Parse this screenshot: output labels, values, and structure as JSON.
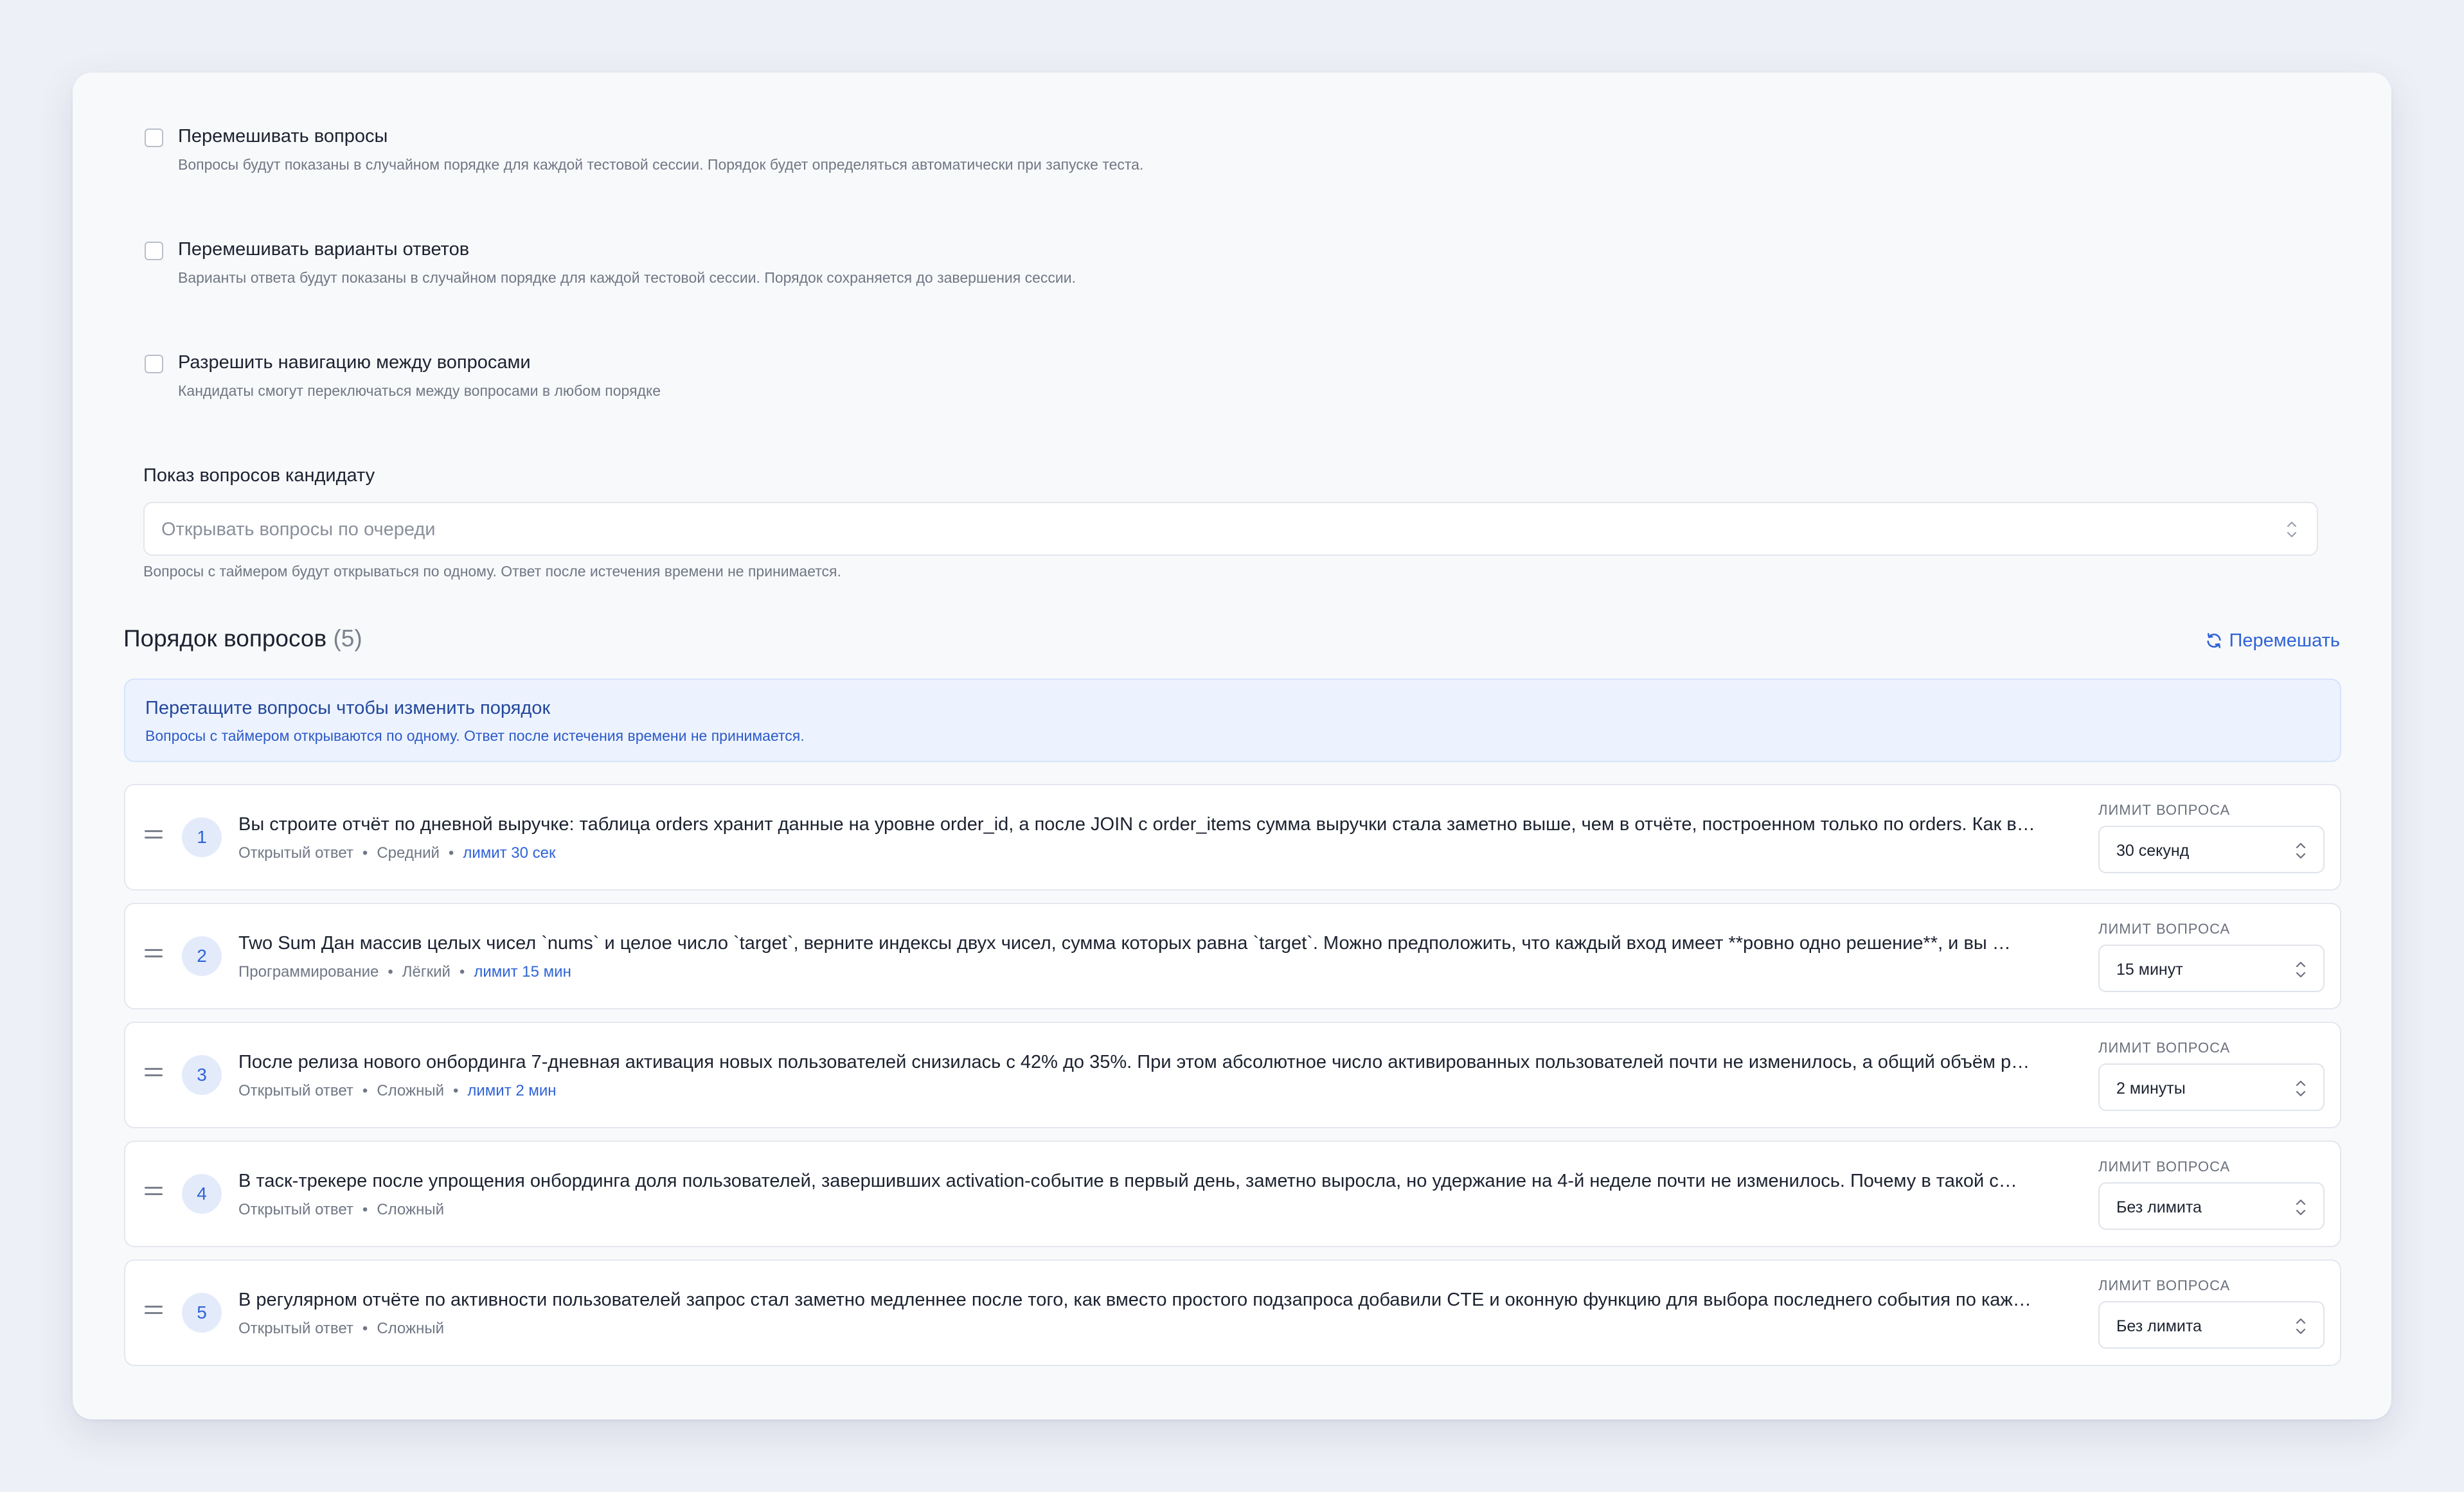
{
  "options": [
    {
      "title": "Перемешивать вопросы",
      "description": "Вопросы будут показаны в случайном порядке для каждой тестовой сессии. Порядок будет определяться автоматически при запуске теста.",
      "checked": false
    },
    {
      "title": "Перемешивать варианты ответов",
      "description": "Варианты ответа будут показаны в случайном порядке для каждой тестовой сессии. Порядок сохраняется до завершения сессии.",
      "checked": false
    },
    {
      "title": "Разрешить навигацию между вопросами",
      "description": "Кандидаты смогут переключаться между вопросами в любом порядке",
      "checked": false
    }
  ],
  "display": {
    "label": "Показ вопросов кандидату",
    "placeholder": "Открывать вопросы по очереди",
    "hint": "Вопросы с таймером будут открываться по одному. Ответ после истечения времени не принимается."
  },
  "order": {
    "title": "Порядок вопросов",
    "count": "(5)",
    "shuffle_label": "Перемешать",
    "info_title": "Перетащите вопросы чтобы изменить порядок",
    "info_sub": "Вопросы с таймером открываются по одному. Ответ после истечения времени не принимается."
  },
  "limit_label": "ЛИМИТ ВОПРОСА",
  "separator": "•",
  "questions": [
    {
      "number": "1",
      "text": "Вы строите отчёт по дневной выручке: таблица orders хранит данные на уровне order_id, а после JOIN с order_items сумма выручки стала заметно выше, чем в отчёте, построенном только по orders. Как в…",
      "type": "Открытый ответ",
      "difficulty": "Средний",
      "limit_badge": "лимит 30 сек",
      "limit_value": "30 секунд"
    },
    {
      "number": "2",
      "text": "Two Sum Дан массив целых чисел `nums` и целое число `target`, верните индексы двух чисел, сумма которых равна `target`. Можно предположить, что каждый вход имеет **ровно одно решение**, и вы …",
      "type": "Программирование",
      "difficulty": "Лёгкий",
      "limit_badge": "лимит 15 мин",
      "limit_value": "15 минут"
    },
    {
      "number": "3",
      "text": "После релиза нового онбординга 7-дневная активация новых пользователей снизилась с 42% до 35%. При этом абсолютное число активированных пользователей почти не изменилось, а общий объём р…",
      "type": "Открытый ответ",
      "difficulty": "Сложный",
      "limit_badge": "лимит 2 мин",
      "limit_value": "2 минуты"
    },
    {
      "number": "4",
      "text": "В таск-трекере после упрощения онбординга доля пользователей, завершивших activation-событие в первый день, заметно выросла, но удержание на 4-й неделе почти не изменилось. Почему в такой с…",
      "type": "Открытый ответ",
      "difficulty": "Сложный",
      "limit_badge": "",
      "limit_value": "Без лимита"
    },
    {
      "number": "5",
      "text": "В регулярном отчёте по активности пользователей запрос стал заметно медленнее после того, как вместо простого подзапроса добавили CTE и оконную функцию для выбора последнего события по каж…",
      "type": "Открытый ответ",
      "difficulty": "Сложный",
      "limit_badge": "",
      "limit_value": "Без лимита"
    }
  ]
}
